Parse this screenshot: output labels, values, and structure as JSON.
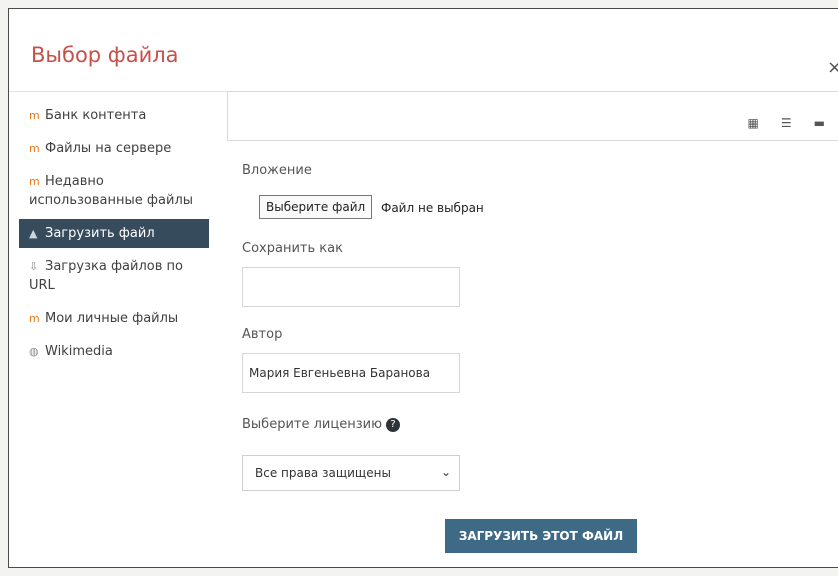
{
  "dialog": {
    "title": "Выбор файла",
    "close": "×"
  },
  "sidebar": {
    "items": [
      {
        "label": "Банк контента",
        "icon": "moodle-repository-icon"
      },
      {
        "label": "Файлы на сервере",
        "icon": "moodle-repository-icon"
      },
      {
        "label": "Недавно использованные файлы",
        "icon": "moodle-repository-icon"
      },
      {
        "label": "Загрузить файл",
        "icon": "upload-icon",
        "active": true
      },
      {
        "label": "Загрузка файлов по URL",
        "icon": "url-download-icon"
      },
      {
        "label": "Мои личные файлы",
        "icon": "moodle-repository-icon"
      },
      {
        "label": "Wikimedia",
        "icon": "wikimedia-globe-icon"
      }
    ]
  },
  "toolbar": {
    "views": [
      "grid-view-icon",
      "list-view-icon",
      "folder-view-icon"
    ]
  },
  "form": {
    "attachment_label": "Вложение",
    "choose_file_button": "Выберите файл",
    "no_file_text": "Файл не выбран",
    "save_as_label": "Сохранить как",
    "save_as_value": "",
    "author_label": "Автор",
    "author_value": "Мария Евгеньевна Баранова",
    "license_label": "Выберите лицензию",
    "license_value": "Все права защищены",
    "upload_button": "ЗАГРУЗИТЬ ЭТОТ ФАЙЛ"
  },
  "colors": {
    "title": "#c8504a",
    "active_item": "#364b5c",
    "primary_button": "#3f6a86",
    "repo_icon": "#e8791e"
  }
}
